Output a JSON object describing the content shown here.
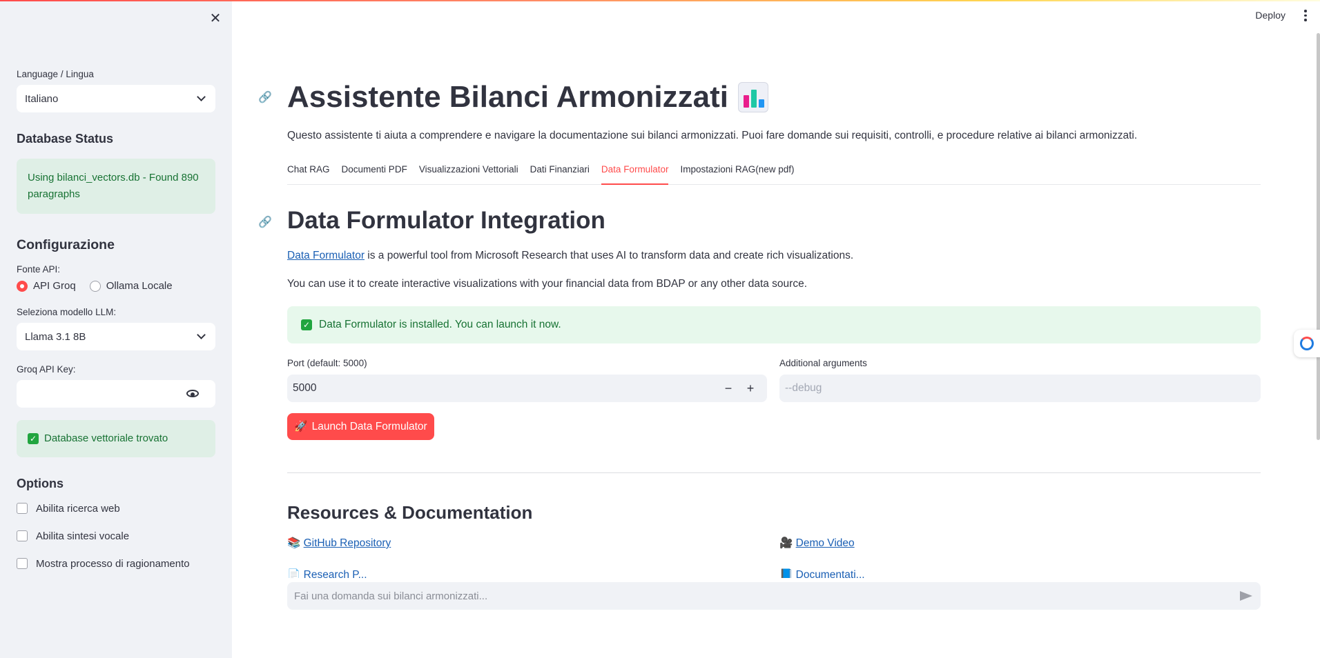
{
  "sidebar": {
    "close_icon": "close-icon",
    "language_label": "Language / Lingua",
    "language_value": "Italiano",
    "db_status_title": "Database Status",
    "db_status_msg": "Using bilanci_vectors.db - Found 890 paragraphs",
    "config_title": "Configurazione",
    "api_source_label": "Fonte API:",
    "api_options": [
      "API Groq",
      "Ollama Locale"
    ],
    "api_selected": "API Groq",
    "model_label": "Seleziona modello LLM:",
    "model_value": "Llama 3.1 8B",
    "api_key_label": "Groq API Key:",
    "api_key_value": "",
    "vector_db_msg": "Database vettoriale trovato",
    "options_title": "Options",
    "options": [
      {
        "label": "Abilita ricerca web",
        "checked": false
      },
      {
        "label": "Abilita sintesi vocale",
        "checked": false
      },
      {
        "label": "Mostra processo di ragionamento",
        "checked": false
      }
    ]
  },
  "header": {
    "deploy_label": "Deploy",
    "menu_icon": "kebab-menu-icon"
  },
  "main": {
    "title": "Assistente Bilanci Armonizzati",
    "title_emoji": "bar-chart-icon",
    "intro": "Questo assistente ti aiuta a comprendere e navigare la documentazione sui bilanci armonizzati. Puoi fare domande sui requisiti, controlli, e procedure relative ai bilanci armonizzati.",
    "tabs": [
      "Chat RAG",
      "Documenti PDF",
      "Visualizzazioni Vettoriali",
      "Dati Finanziari",
      "Data Formulator",
      "Impostazioni RAG(new pdf)"
    ],
    "active_tab": "Data Formulator",
    "section_title": "Data Formulator Integration",
    "df_link": "Data Formulator",
    "df_desc": " is a powerful tool from Microsoft Research that uses AI to transform data and create rich visualizations.",
    "df_usage": "You can use it to create interactive visualizations with your financial data from BDAP or any other data source.",
    "installed_msg": "Data Formulator is installed. You can launch it now.",
    "port_label": "Port (default: 5000)",
    "port_value": "5000",
    "args_label": "Additional arguments",
    "args_placeholder": "--debug",
    "launch_label": "Launch Data Formulator",
    "resources_title": "Resources & Documentation",
    "resources": [
      {
        "icon": "books-icon",
        "label": "GitHub Repository"
      },
      {
        "icon": "video-camera-icon",
        "label": "Demo Video"
      },
      {
        "icon": "page-icon",
        "label": "Research P..."
      },
      {
        "icon": "doc-icon",
        "label": "Documentati..."
      }
    ],
    "chat_placeholder": "Fai una domanda sui bilanci armonizzati..."
  },
  "colors": {
    "accent": "#ff4b4b",
    "sidebar_bg": "#f0f2f6",
    "success_bg": "#dfefe6",
    "success_text": "#177233",
    "link": "#1a5fb4"
  }
}
